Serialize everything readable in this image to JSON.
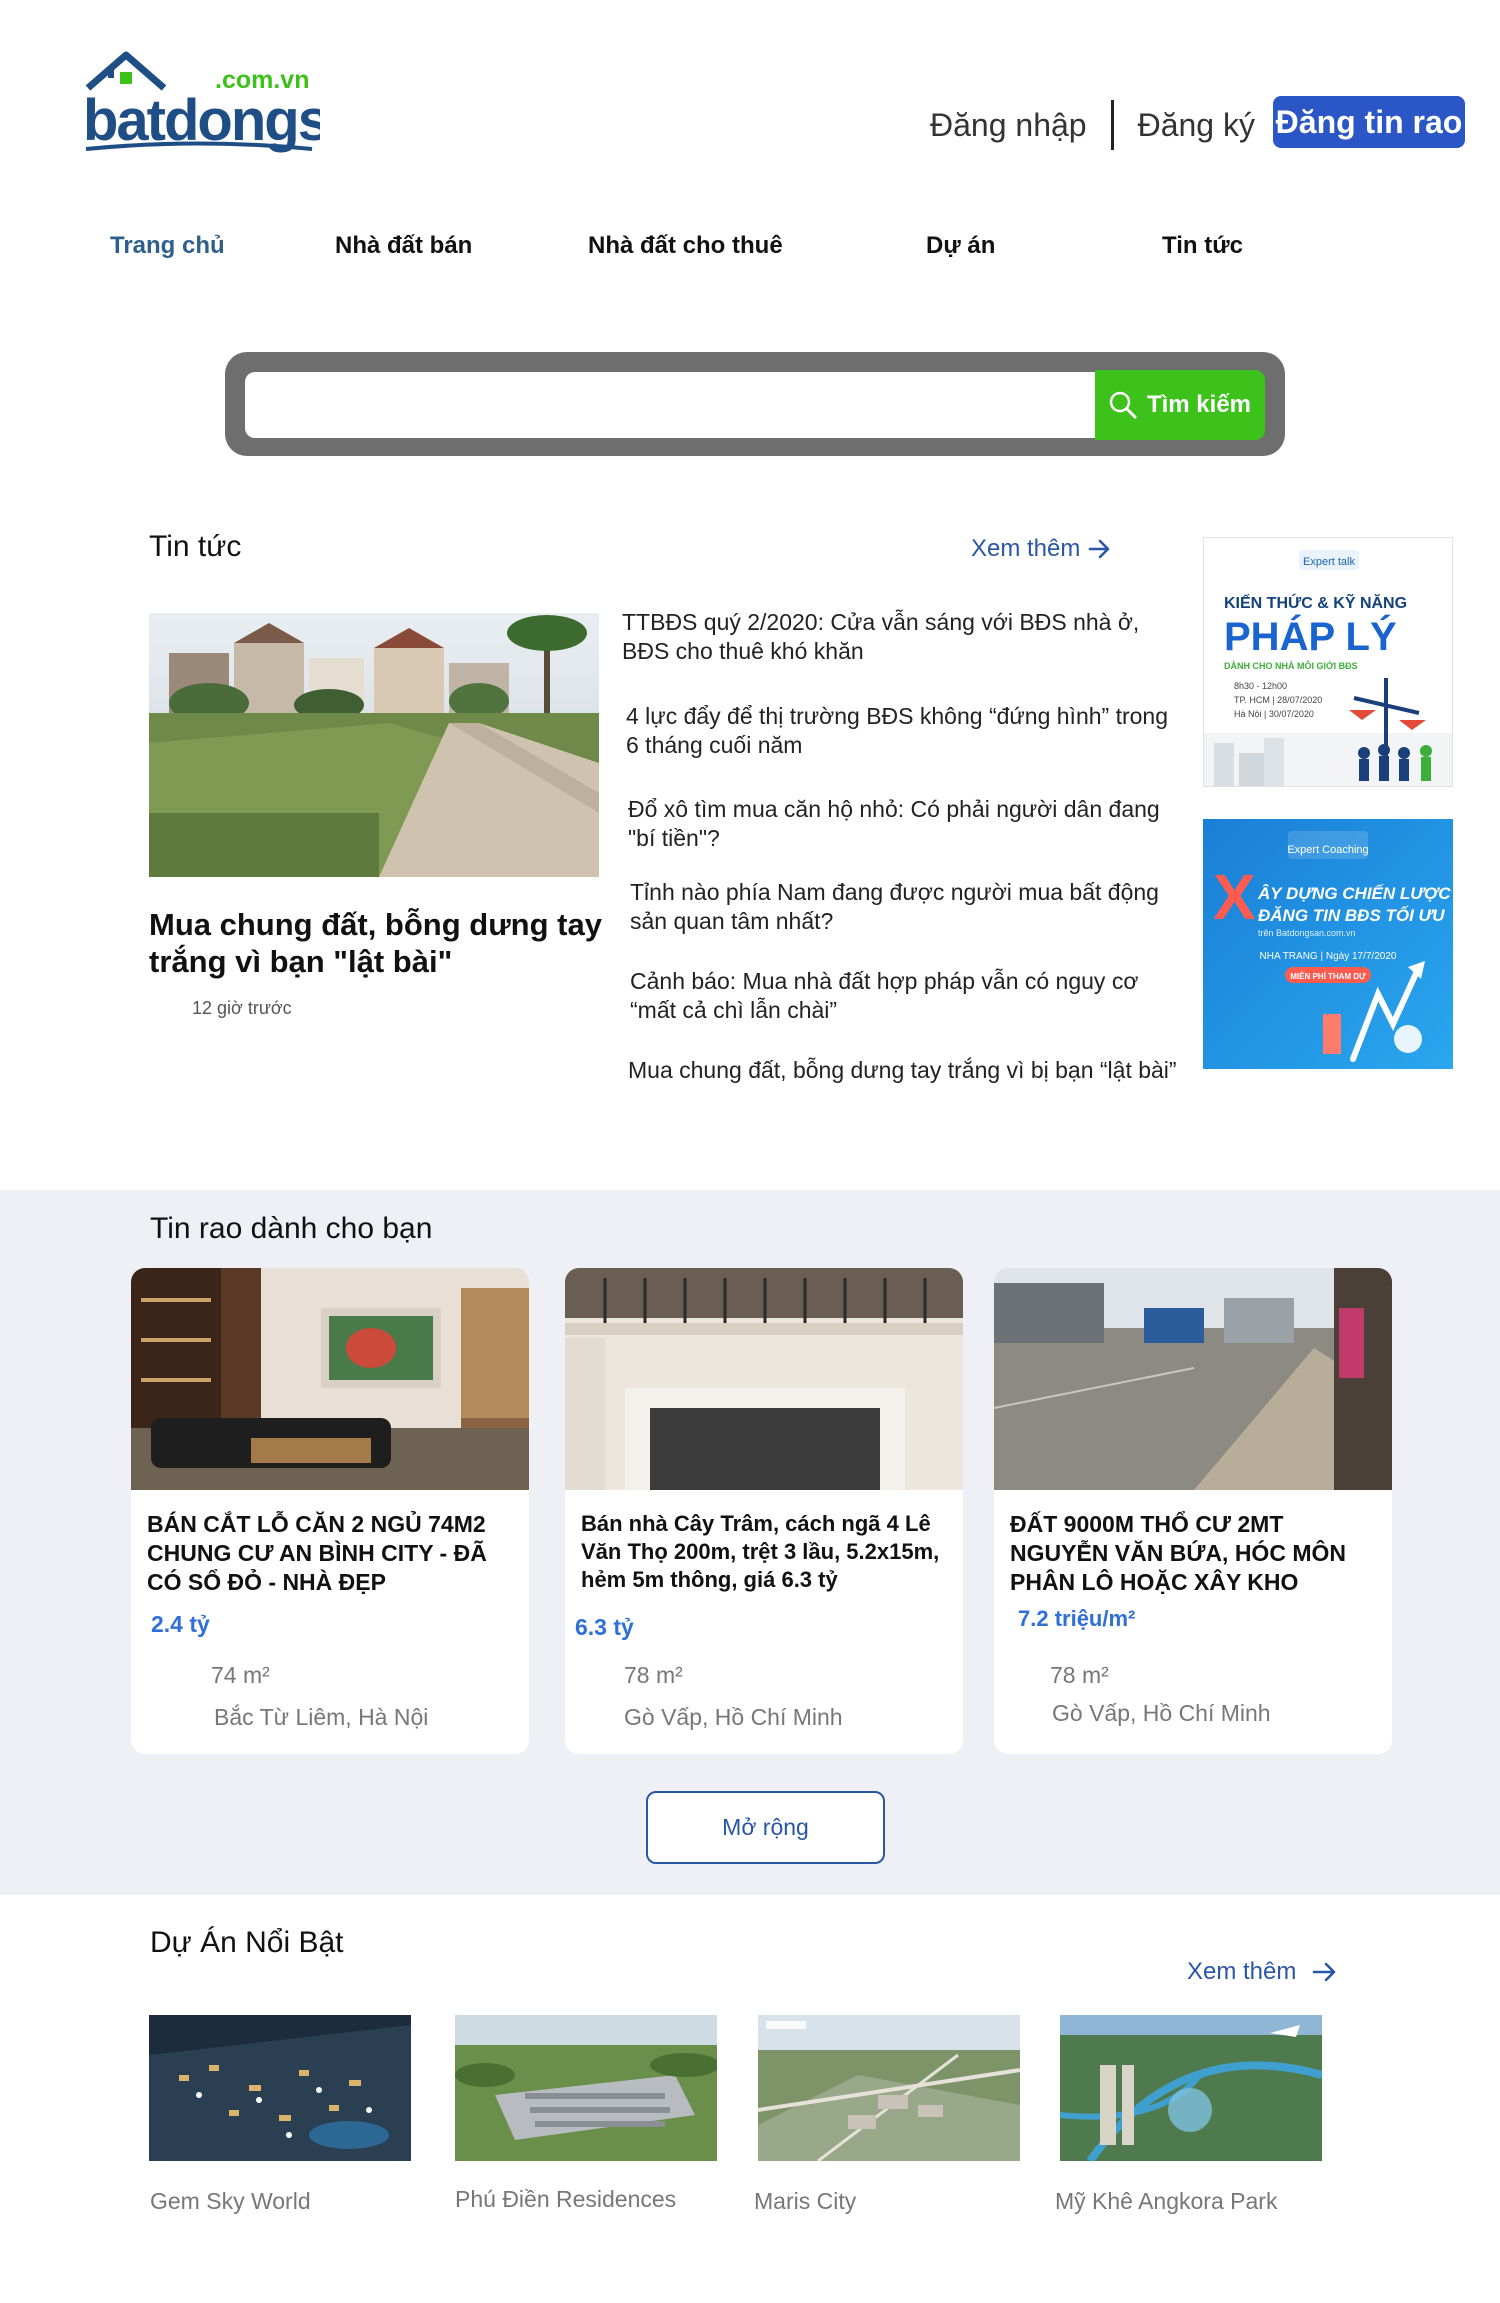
{
  "header": {
    "logo_main": "batdongsan",
    "logo_suffix": ".com.vn",
    "login": "Đăng nhập",
    "register": "Đăng ký",
    "post_listing": "Đăng tin rao"
  },
  "nav": {
    "items": [
      "Trang chủ",
      "Nhà đất bán",
      "Nhà đất cho thuê",
      "Dự án",
      "Tin tức"
    ]
  },
  "search": {
    "placeholder": "",
    "button": "Tìm kiếm"
  },
  "news": {
    "title": "Tin tức",
    "see_more": "Xem thêm",
    "featured": {
      "title": "Mua chung đất, bỗng dưng tay trắng vì bạn \"lật bài\"",
      "time": "12 giờ trước"
    },
    "items": [
      "TTBĐS quý 2/2020: Cửa vẫn sáng với BĐS nhà ở, BĐS cho thuê khó khăn",
      "4 lực đẩy để thị trường BĐS không “đứng hình” trong 6 tháng cuối năm",
      "Đổ xô tìm mua căn hộ nhỏ: Có phải người dân đang \"bí tiền\"?",
      "Tỉnh nào phía Nam đang được người mua bất động sản quan tâm nhất?",
      "Cảnh báo: Mua nhà đất hợp pháp vẫn có nguy cơ “mất cả chì lẫn chài”",
      "Mua chung đất, bỗng dưng tay trắng vì bị bạn “lật bài”"
    ],
    "ads": {
      "ad1": {
        "brand": "Expert talk",
        "line1": "KIẾN THỨC & KỸ NĂNG",
        "line2": "PHÁP LÝ",
        "line3": "DÀNH CHO NHÀ MÔI GIỚI BĐS",
        "d1": "8h30 - 12h00",
        "d2": "TP. HCM | 28/07/2020",
        "d3": "Hà Nội | 30/07/2020"
      },
      "ad2": {
        "brand": "Expert Coaching",
        "line1": "ÂY DỰNG CHIẾN LƯỢC",
        "line2": "ĐĂNG TIN BĐS TỐI ƯU",
        "line3": "trên Batdongsan.com.vn",
        "line4": "NHA TRANG | Ngày 17/7/2020",
        "cta": "MIỄN PHÍ THAM DỰ"
      }
    }
  },
  "listings": {
    "title": "Tin rao dành cho bạn",
    "expand": "Mở rộng",
    "cards": [
      {
        "title": "BÁN CẮT LỖ CĂN 2 NGỦ 74M2 CHUNG CƯ AN BÌNH CITY - ĐÃ CÓ SỔ ĐỎ - NHÀ ĐẸP",
        "price": "2.4 tỷ",
        "area": "74 m²",
        "location": "Bắc Từ Liêm, Hà Nội"
      },
      {
        "title": "Bán nhà Cây Trâm, cách ngã 4 Lê Văn Thọ 200m, trệt 3 lầu, 5.2x15m, hẻm 5m thông, giá 6.3 tỷ",
        "price": "6.3 tỷ",
        "area": "78 m²",
        "location": "Gò Vấp, Hồ Chí Minh"
      },
      {
        "title": "ĐẤT 9000M THỔ CƯ 2MT NGUYỄN VĂN BỨA, HÓC MÔN PHÂN LÔ HOẶC XÂY KHO",
        "price": "7.2 triệu/m²",
        "area": "78 m²",
        "location": "Gò Vấp, Hồ Chí Minh"
      }
    ]
  },
  "projects": {
    "title": "Dự Án Nổi Bật",
    "see_more": "Xem thêm",
    "items": [
      "Gem Sky World",
      "Phú Điền Residences",
      "Maris City",
      "Mỹ Khê Angkora Park"
    ]
  },
  "colors": {
    "brand_blue": "#2a56c6",
    "logo_blue": "#1f4e86",
    "search_green": "#3dc21b",
    "price_blue": "#2f6fd8",
    "nav_active": "#2f5f8f"
  }
}
